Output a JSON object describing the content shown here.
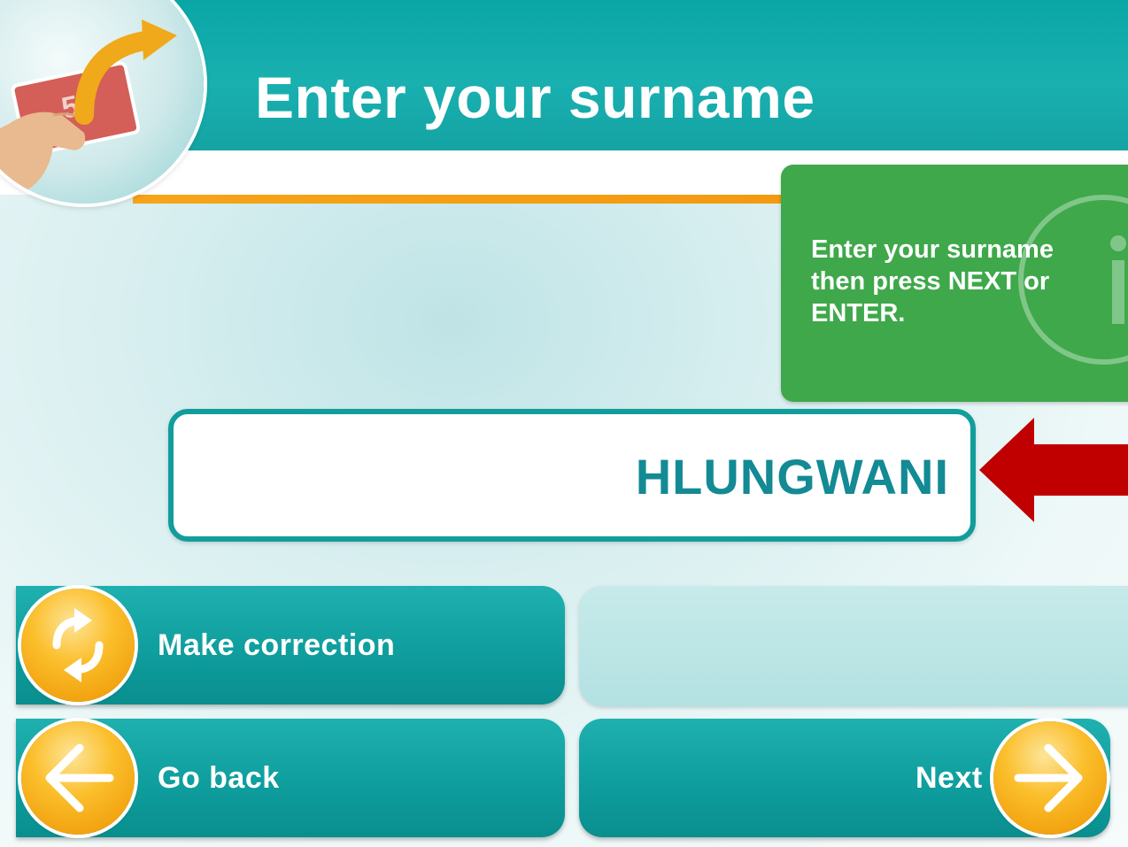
{
  "header": {
    "title": "Enter your surname",
    "logo_number": "50"
  },
  "info": {
    "text": "Enter your surname\nthen press NEXT or\nENTER.",
    "icon": "info-icon"
  },
  "input": {
    "value": "HLUNGWANI"
  },
  "buttons": {
    "correction_label": "Make correction",
    "back_label": "Go back",
    "next_label": "Next"
  },
  "colors": {
    "teal": "#0aa6a6",
    "orange": "#f6a419",
    "green": "#3ea84a",
    "arrow_red": "#c00000",
    "input_text": "#138a94"
  }
}
